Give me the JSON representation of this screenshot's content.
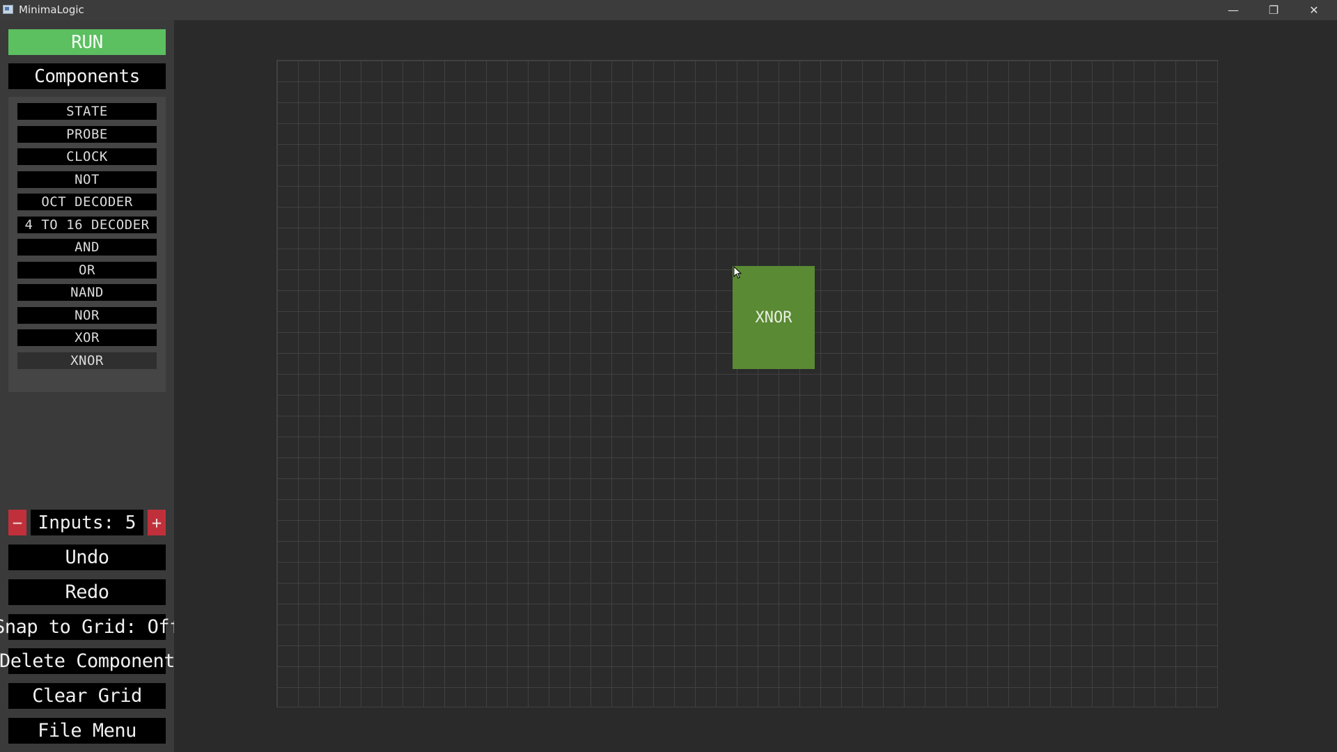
{
  "window": {
    "title": "MinimaLogic",
    "minimize_glyph": "—",
    "maximize_glyph": "❐",
    "close_glyph": "✕"
  },
  "sidebar": {
    "run_label": "RUN",
    "components_label": "Components",
    "components": [
      {
        "label": "STATE"
      },
      {
        "label": "PROBE"
      },
      {
        "label": "CLOCK"
      },
      {
        "label": "NOT"
      },
      {
        "label": "OCT DECODER"
      },
      {
        "label": "4 TO 16 DECODER"
      },
      {
        "label": "AND"
      },
      {
        "label": "OR"
      },
      {
        "label": "NAND"
      },
      {
        "label": "NOR"
      },
      {
        "label": "XOR"
      },
      {
        "label": "XNOR",
        "selected": true
      }
    ],
    "inputs": {
      "label": "Inputs: 5",
      "minus": "−",
      "plus": "+"
    },
    "undo_label": "Undo",
    "redo_label": "Redo",
    "snap_label": "Snap to Grid: Off",
    "delete_label": "Delete Component",
    "clear_label": "Clear Grid",
    "file_menu_label": "File Menu"
  },
  "canvas": {
    "placed_component": {
      "label": "XNOR"
    }
  },
  "colors": {
    "run": "#5cbf60",
    "component_fill": "#5a8a34",
    "stepper": "#c0303a",
    "background": "#2a2a2a",
    "sidebar": "#3a3a3a"
  }
}
